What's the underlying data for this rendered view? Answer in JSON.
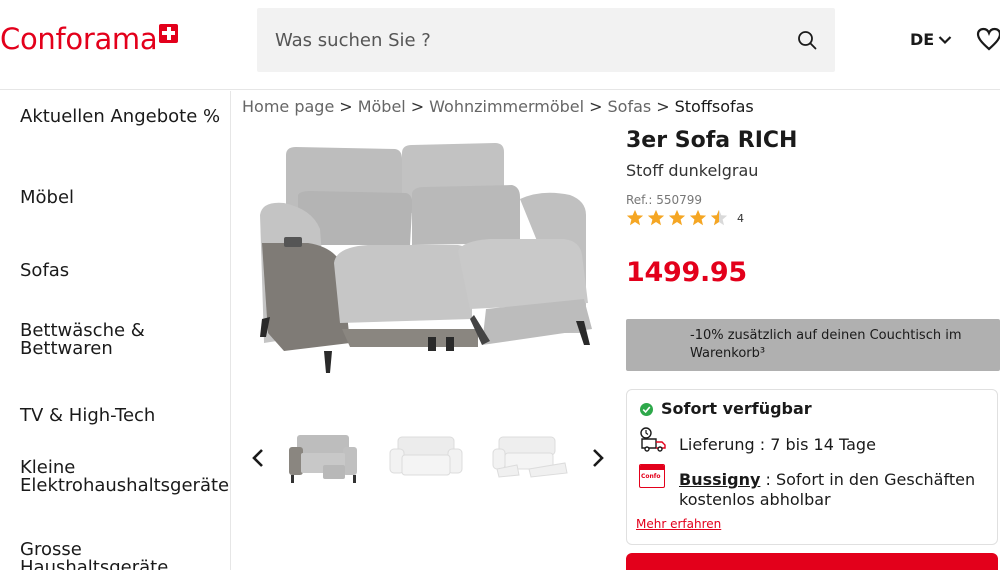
{
  "header": {
    "logo_text": "Conforama",
    "search_placeholder": "Was suchen Sie ?",
    "language": "DE"
  },
  "sidebar": {
    "items": [
      {
        "label": "Aktuellen Angebote %"
      },
      {
        "label": "Möbel"
      },
      {
        "label": "Sofas"
      },
      {
        "label": "Bettwäsche & Bettwaren"
      },
      {
        "label": "TV & High-Tech"
      },
      {
        "label": "Kleine Elektrohaushaltsgeräte"
      },
      {
        "label": "Grosse Haushaltsgeräte"
      }
    ]
  },
  "breadcrumb": {
    "items": [
      "Home page",
      "Möbel",
      "Wohnzimmermöbel",
      "Sofas"
    ],
    "current": "Stoffsofas",
    "separator": ">"
  },
  "product": {
    "title": "3er Sofa RICH",
    "subtitle": "Stoff dunkelgrau",
    "ref": "Ref.: 550799",
    "rating": 4.5,
    "rating_count": "4",
    "price": "1499.95",
    "price_color": "#e3001b",
    "thumbnails": [
      "grey-sofa-thumbnail",
      "white-sofa-thumbnail",
      "white-recliner-thumbnail"
    ]
  },
  "promo": {
    "text": "-10% zusätzlich auf deinen Couchtisch im Warenkorb³"
  },
  "availability": {
    "title": "Sofort verfügbar",
    "delivery": "Lieferung : 7 bis 14 Tage",
    "store_name": "Bussigny",
    "store_text": " : Sofort in den Geschäften kostenlos abholbar",
    "store_icon_label": "Confo",
    "more_link": "Mehr erfahren"
  },
  "colors": {
    "brand_red": "#e3001b",
    "promo_bg": "#b0b0b0",
    "available_green": "#2da84a",
    "star_gold": "#f5a623"
  }
}
